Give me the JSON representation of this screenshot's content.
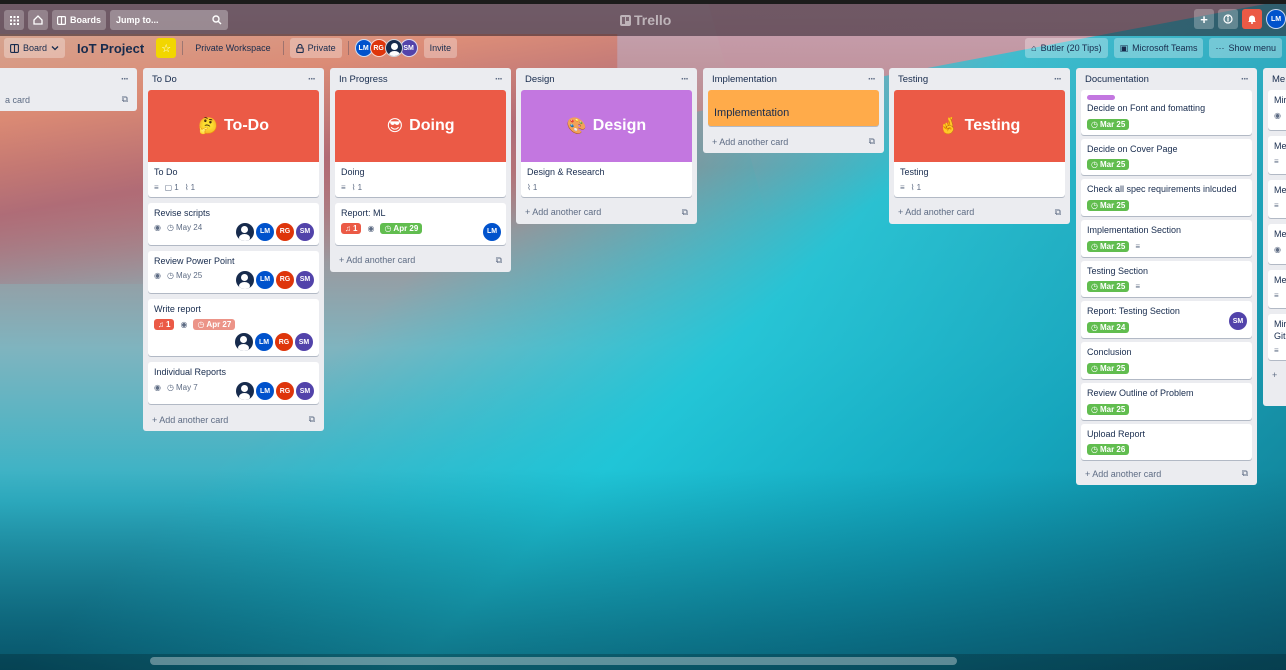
{
  "topbar": {
    "boards_label": "Boards",
    "search_placeholder": "Jump to...",
    "logo_text": "Trello",
    "user_initials": "LM"
  },
  "boardbar": {
    "view_label": "Board",
    "title": "IoT Project",
    "workspace_label": "Private Workspace",
    "visibility_label": "Private",
    "invite_label": "Invite",
    "members": [
      "LM",
      "RG",
      "",
      "SM"
    ],
    "butler_label": "Butler (20 Tips)",
    "teams_label": "Microsoft Teams",
    "menu_label": "Show menu"
  },
  "colors": {
    "cover_red": "#eb5a46",
    "cover_purple": "#c377e0",
    "cover_orange": "#ffab4a",
    "due_green": "#61bd4f"
  },
  "lists": {
    "partial_left": {
      "add_label": "a card"
    },
    "todo": {
      "title": "To Do",
      "cover_title": "To-Do",
      "cards": [
        {
          "title": "To Do",
          "comments": "1",
          "attachments": "1"
        },
        {
          "title": "Revise scripts",
          "date": "May 24"
        },
        {
          "title": "Review Power Point",
          "date": "May 25"
        },
        {
          "title": "Write report",
          "notifications": "1",
          "date": "Apr 27"
        },
        {
          "title": "Individual Reports",
          "date": "May 7"
        }
      ],
      "add_label": "Add another card"
    },
    "inprogress": {
      "title": "In Progress",
      "cover_title": "Doing",
      "cards": [
        {
          "title": "Doing",
          "attachments": "1"
        },
        {
          "title": "Report: ML",
          "notifications": "1",
          "date": "Apr 29"
        }
      ],
      "add_label": "Add another card"
    },
    "design": {
      "title": "Design",
      "cover_title": "Design",
      "cards": [
        {
          "title": "Design & Research",
          "attachments": "1"
        }
      ],
      "add_label": "Add another card"
    },
    "implementation": {
      "title": "Implementation",
      "cards": [
        {
          "title": "Implementation"
        }
      ],
      "add_label": "Add another card"
    },
    "testing": {
      "title": "Testing",
      "cover_title": "Testing",
      "cards": [
        {
          "title": "Testing",
          "attachments": "1"
        }
      ],
      "add_label": "Add another card"
    },
    "documentation": {
      "title": "Documentation",
      "cards": [
        {
          "title": "Decide on Font and fomatting",
          "date": "Mar 25"
        },
        {
          "title": "Decide on Cover Page",
          "date": "Mar 25"
        },
        {
          "title": "Check all spec requirements inlcuded",
          "date": "Mar 25"
        },
        {
          "title": "Implementation Section",
          "date": "Mar 25"
        },
        {
          "title": "Testing Section",
          "date": "Mar 25"
        },
        {
          "title": "Report: Testing Section",
          "date": "Mar 24"
        },
        {
          "title": "Conclusion",
          "date": "Mar 25"
        },
        {
          "title": "Review Outline of Problem",
          "date": "Mar 25"
        },
        {
          "title": "Upload Report",
          "date": "Mar 26"
        }
      ],
      "add_label": "Add another card"
    },
    "partial_right": {
      "title": "Me",
      "cards": [
        "Mir",
        "Me",
        "Me",
        "Me",
        "Me",
        "Mir Git"
      ]
    }
  }
}
